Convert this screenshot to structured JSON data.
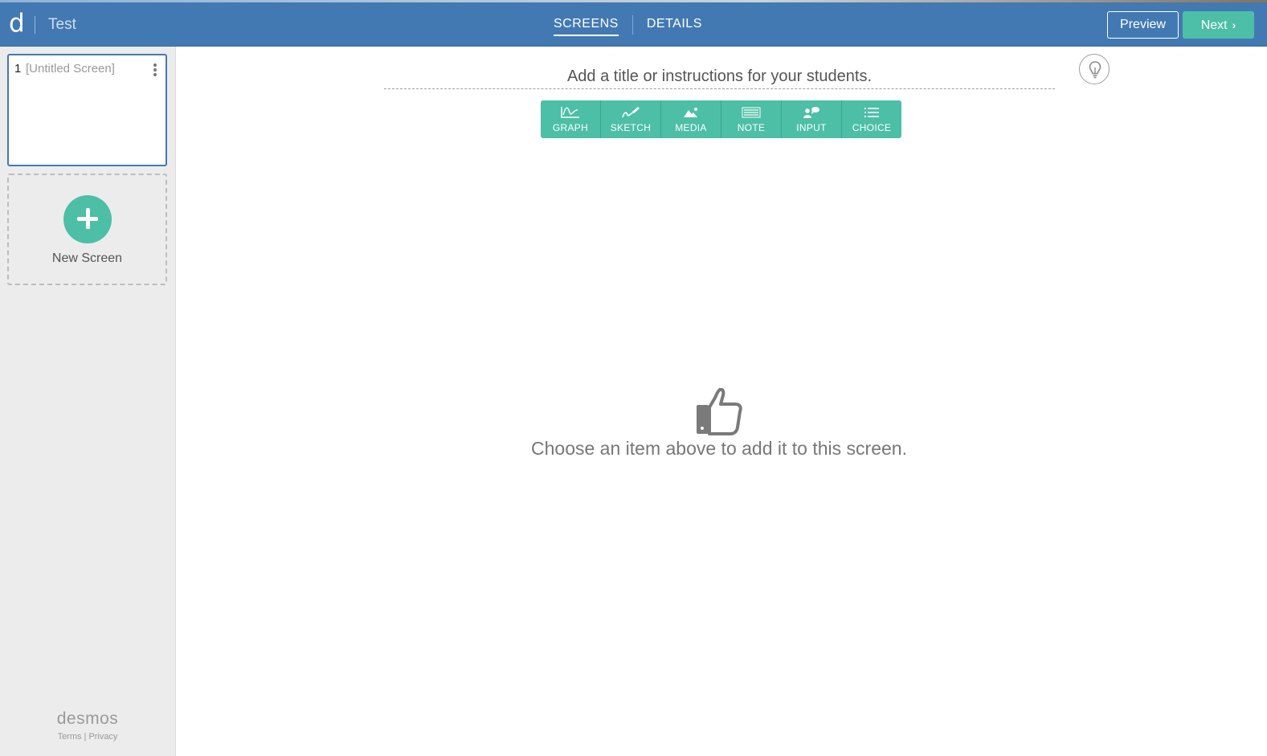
{
  "header": {
    "logo": "d",
    "doc_title": "Test",
    "tabs": [
      {
        "label": "SCREENS",
        "active": true
      },
      {
        "label": "DETAILS",
        "active": false
      }
    ],
    "preview_label": "Preview",
    "next_label": "Next"
  },
  "sidebar": {
    "screens": [
      {
        "number": "1",
        "name": "[Untitled Screen]"
      }
    ],
    "new_screen_label": "New Screen",
    "brand": "desmos",
    "footer": {
      "terms": "Terms",
      "separator": "|",
      "privacy": "Privacy"
    }
  },
  "editor": {
    "instructions_placeholder": "Add a title or instructions for your students.",
    "tools": [
      {
        "label": "GRAPH",
        "icon": "graph-icon"
      },
      {
        "label": "SKETCH",
        "icon": "sketch-icon"
      },
      {
        "label": "MEDIA",
        "icon": "media-icon"
      },
      {
        "label": "NOTE",
        "icon": "note-icon"
      },
      {
        "label": "INPUT",
        "icon": "input-icon"
      },
      {
        "label": "CHOICE",
        "icon": "choice-icon"
      }
    ],
    "empty_state_icon": "thumbs-up-icon",
    "empty_state_message": "Choose an item above to add it to this screen."
  },
  "colors": {
    "header_bg": "#4379b2",
    "accent_green": "#4cbfa6",
    "sidebar_bg": "#ececec"
  }
}
